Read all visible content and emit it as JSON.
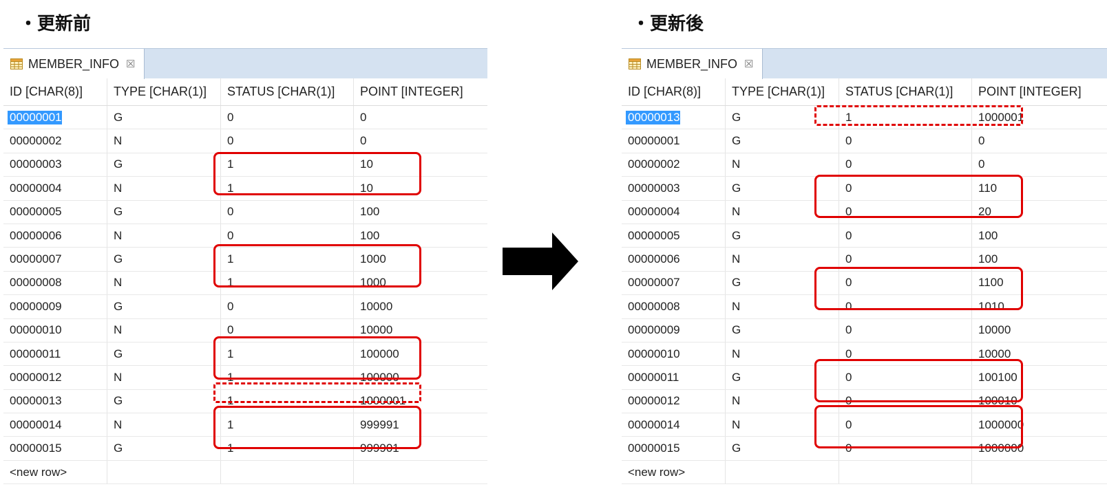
{
  "headings": {
    "before": "・更新前",
    "after": "・更新後"
  },
  "tab": {
    "label": "MEMBER_INFO",
    "close_glyph": "☒",
    "icon": "table-icon"
  },
  "columns": [
    "ID [CHAR(8)]",
    "TYPE [CHAR(1)]",
    "STATUS [CHAR(1)]",
    "POINT [INTEGER]"
  ],
  "new_row_label": "<new row>",
  "before_rows": [
    [
      "00000001",
      "G",
      "0",
      "0"
    ],
    [
      "00000002",
      "N",
      "0",
      "0"
    ],
    [
      "00000003",
      "G",
      "1",
      "10"
    ],
    [
      "00000004",
      "N",
      "1",
      "10"
    ],
    [
      "00000005",
      "G",
      "0",
      "100"
    ],
    [
      "00000006",
      "N",
      "0",
      "100"
    ],
    [
      "00000007",
      "G",
      "1",
      "1000"
    ],
    [
      "00000008",
      "N",
      "1",
      "1000"
    ],
    [
      "00000009",
      "G",
      "0",
      "10000"
    ],
    [
      "00000010",
      "N",
      "0",
      "10000"
    ],
    [
      "00000011",
      "G",
      "1",
      "100000"
    ],
    [
      "00000012",
      "N",
      "1",
      "100000"
    ],
    [
      "00000013",
      "G",
      "1",
      "1000001"
    ],
    [
      "00000014",
      "N",
      "1",
      "999991"
    ],
    [
      "00000015",
      "G",
      "1",
      "999901"
    ]
  ],
  "after_rows": [
    [
      "00000013",
      "G",
      "1",
      "1000001"
    ],
    [
      "00000001",
      "G",
      "0",
      "0"
    ],
    [
      "00000002",
      "N",
      "0",
      "0"
    ],
    [
      "00000003",
      "G",
      "0",
      "110"
    ],
    [
      "00000004",
      "N",
      "0",
      "20"
    ],
    [
      "00000005",
      "G",
      "0",
      "100"
    ],
    [
      "00000006",
      "N",
      "0",
      "100"
    ],
    [
      "00000007",
      "G",
      "0",
      "1100"
    ],
    [
      "00000008",
      "N",
      "0",
      "1010"
    ],
    [
      "00000009",
      "G",
      "0",
      "10000"
    ],
    [
      "00000010",
      "N",
      "0",
      "10000"
    ],
    [
      "00000011",
      "G",
      "0",
      "100100"
    ],
    [
      "00000012",
      "N",
      "0",
      "100010"
    ],
    [
      "00000014",
      "N",
      "0",
      "1000000"
    ],
    [
      "00000015",
      "G",
      "0",
      "1000000"
    ]
  ],
  "colors": {
    "highlight": "#e00000",
    "selection": "#3399ff",
    "tabbar": "#d5e2f1"
  }
}
